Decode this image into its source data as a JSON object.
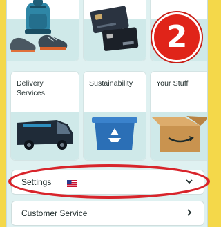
{
  "step_badge": "2",
  "cards": [
    {
      "id": "backpack",
      "label": ""
    },
    {
      "id": "gift-cards",
      "label": ""
    },
    {
      "id": "blank",
      "label": ""
    },
    {
      "id": "delivery",
      "label": "Delivery\nServices"
    },
    {
      "id": "sustainability",
      "label": "Sustainability"
    },
    {
      "id": "your-stuff",
      "label": "Your Stuff"
    }
  ],
  "rows": {
    "settings": {
      "label": "Settings",
      "icon": "us-flag-icon",
      "chevron": "chevron-down-icon"
    },
    "customer_service": {
      "label": "Customer Service",
      "chevron": "chevron-right-icon"
    }
  },
  "colors": {
    "background": "#f4d84a",
    "panel": "#dff1f1",
    "highlight": "#d8242b",
    "badge": "#e02419"
  }
}
